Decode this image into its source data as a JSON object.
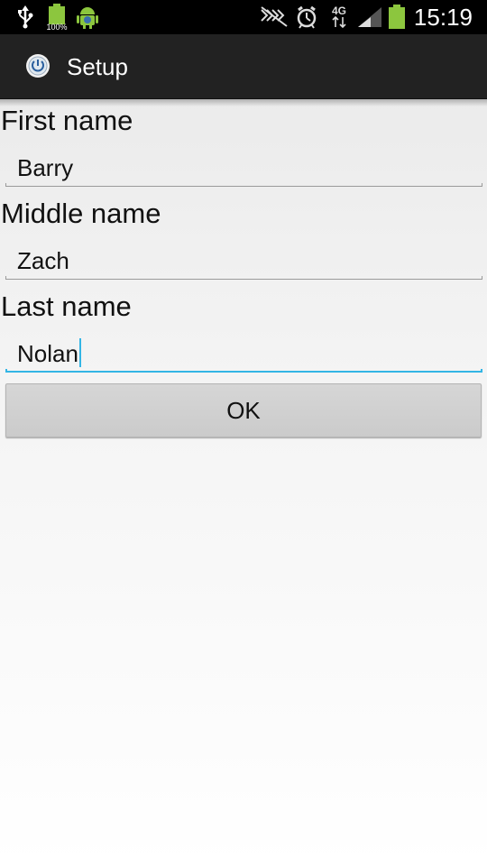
{
  "status_bar": {
    "time": "15:19",
    "battery_text": "100%",
    "network_label": "4G",
    "icons": [
      "usb-icon",
      "battery-full-icon",
      "android-debug-icon",
      "no-signal-icon",
      "alarm-icon",
      "4g-data-icon",
      "signal-strength-icon",
      "battery-icon"
    ],
    "colors": {
      "battery": "#8cc63e",
      "background": "#000000"
    }
  },
  "action_bar": {
    "title": "Setup",
    "icon": "power-app-icon"
  },
  "form": {
    "first_name_label": "First name",
    "first_name_value": "Barry",
    "middle_name_label": "Middle name",
    "middle_name_value": "Zach",
    "last_name_label": "Last name",
    "last_name_value": "Nolan",
    "ok_label": "OK"
  },
  "colors": {
    "focus_accent": "#33b5e5",
    "action_bar": "#222222"
  }
}
